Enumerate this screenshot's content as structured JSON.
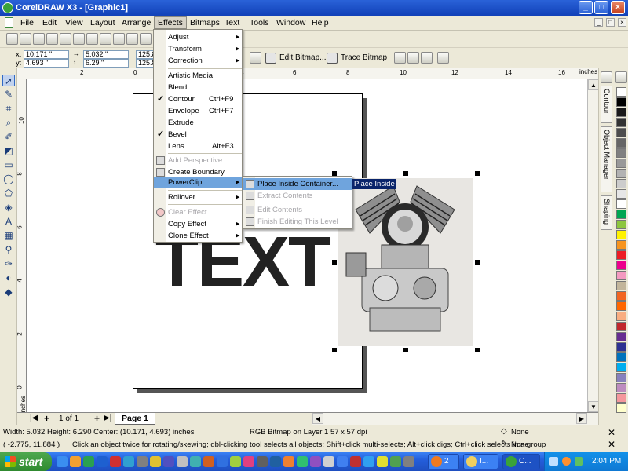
{
  "window": {
    "title": "CorelDRAW X3 - [Graphic1]",
    "minimize": "_",
    "maximize": "□",
    "close": "×",
    "mdi_min": "_",
    "mdi_restore": "□",
    "mdi_close": "×"
  },
  "menubar": [
    "File",
    "Edit",
    "View",
    "Layout",
    "Arrange",
    "Effects",
    "Bitmaps",
    "Text",
    "Tools",
    "Window",
    "Help"
  ],
  "propbar": {
    "x_label": "x:",
    "x_value": "10.171 \"",
    "y_label": "y:",
    "y_value": "4.693 \"",
    "w_value": "5.032 \"",
    "h_value": "6.29 \"",
    "sx_value": "125.8",
    "sy_value": "125.8",
    "edit_bitmap": "Edit Bitmap...",
    "trace_bitmap": "Trace Bitmap"
  },
  "ruler": {
    "units": "inches",
    "h_ticks": [
      "2",
      "0",
      "2",
      "4",
      "6",
      "8",
      "10",
      "12",
      "14",
      "16"
    ],
    "v_ticks": [
      "10",
      "8",
      "6",
      "4",
      "2",
      "0"
    ],
    "v_units": "inches"
  },
  "canvas": {
    "big_text": "TEXT"
  },
  "effects_menu": {
    "items": [
      {
        "label": "Adjust",
        "submenu": true
      },
      {
        "label": "Transform",
        "submenu": true
      },
      {
        "label": "Correction",
        "submenu": true
      },
      {
        "label": "Artistic Media"
      },
      {
        "label": "Blend"
      },
      {
        "label": "Contour",
        "shortcut": "Ctrl+F9",
        "checked": true
      },
      {
        "label": "Envelope",
        "shortcut": "Ctrl+F7"
      },
      {
        "label": "Extrude"
      },
      {
        "label": "Bevel",
        "checked": true
      },
      {
        "label": "Lens",
        "shortcut": "Alt+F3"
      },
      {
        "label": "Add Perspective",
        "disabled": true
      },
      {
        "label": "Create Boundary"
      },
      {
        "label": "PowerClip",
        "submenu": true,
        "highlighted": true
      },
      {
        "label": "Rollover",
        "submenu": true
      },
      {
        "label": "Clear Effect",
        "disabled": true
      },
      {
        "label": "Copy Effect",
        "submenu": true
      },
      {
        "label": "Clone Effect",
        "submenu": true
      }
    ]
  },
  "powerclip_menu": {
    "items": [
      {
        "label": "Place Inside Container...",
        "highlighted": true
      },
      {
        "label": "Extract Contents",
        "disabled": true
      },
      {
        "label": "Edit Contents",
        "disabled": true
      },
      {
        "label": "Finish Editing This Level",
        "disabled": true
      }
    ]
  },
  "tooltip": "Place Inside",
  "dockers": [
    "Contour",
    "Object Manager",
    "Shaping"
  ],
  "palette_colors": [
    "#ffffff",
    "#000000",
    "#1a1a1a",
    "#333333",
    "#4d4d4d",
    "#666666",
    "#808080",
    "#999999",
    "#b3b3b3",
    "#cccccc",
    "#e6e6e6",
    "#ffffff",
    "#00a651",
    "#8dc63f",
    "#fff200",
    "#f7941d",
    "#ed1c24",
    "#ec008c",
    "#f49ac1",
    "#c2b59b",
    "#f26522",
    "#ff6600",
    "#f9ad81",
    "#c1272d",
    "#662d91",
    "#2e3192",
    "#0072bc",
    "#00aeef",
    "#8781bd",
    "#bd8cbf",
    "#f5989d",
    "#ffffcc"
  ],
  "navbar": {
    "page_info": "1 of 1",
    "page_tab": "Page 1"
  },
  "status": {
    "dims": "Width: 5.032  Height: 6.290  Center: (10.171, 4.693)  inches",
    "object": "RGB Bitmap on Layer 1 57 x 57 dpi",
    "fill": "None",
    "outline": "None",
    "cursor": "( -2.775, 11.884 )",
    "hint": "Click an object twice for rotating/skewing; dbl-clicking tool selects all objects; Shift+click multi-selects; Alt+click digs; Ctrl+click selects in a group"
  },
  "taskbar": {
    "start": "start",
    "tasks": [
      "2",
      "I...",
      "C..."
    ],
    "clock": "2:04 PM"
  }
}
